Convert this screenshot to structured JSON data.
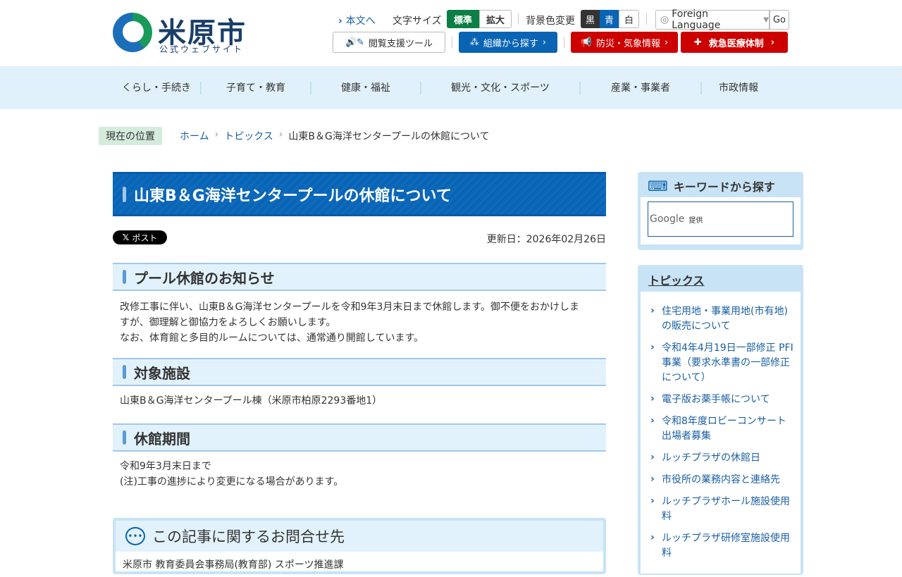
{
  "header": {
    "site_name": "米原市",
    "site_sub": "公式ウェブサイト",
    "skip_link": "本文へ",
    "font_size_label": "文字サイズ",
    "font_standard": "標準",
    "font_large": "拡大",
    "bg_label": "背景色変更",
    "bg_black": "黒",
    "bg_blue": "青",
    "bg_white": "白",
    "language": "Foreign Language",
    "go": "Go",
    "reading_tool": "閲覧支援ツール",
    "org_search": "組織から探す",
    "disaster": "防災・気象情報",
    "emergency": "救急医療体制"
  },
  "nav": [
    "くらし・手続き",
    "子育て・教育",
    "健康・福祉",
    "観光・文化・スポーツ",
    "産業・事業者",
    "市政情報"
  ],
  "breadcrumb": {
    "label": "現在の位置",
    "items": [
      "ホーム",
      "トピックス",
      "山東B＆G海洋センタープールの休館について"
    ]
  },
  "article": {
    "title": "山東B＆G海洋センタープールの休館について",
    "post_button": "ポスト",
    "updated": "更新日：2026年02月26日",
    "sections": [
      {
        "heading": "プール休館のお知らせ",
        "lines": [
          "改修工事に伴い、山東B＆G海洋センタープールを令和9年3月末日まで休館します。御不便をおかけしま",
          "すが、御理解と御協力をよろしくお願いします。",
          "なお、体育館と多目的ルームについては、通常通り開館しています。"
        ]
      },
      {
        "heading": "対象施設",
        "lines": [
          "山東B＆G海洋センタープール棟（米原市柏原2293番地1）"
        ]
      },
      {
        "heading": "休館期間",
        "lines": [
          "令和9年3月末日まで",
          "(注)工事の進捗により変更になる場合があります。"
        ]
      }
    ],
    "contact_heading": "この記事に関するお問合せ先",
    "contact_text": "米原市 教育委員会事務局(教育部) スポーツ推進課"
  },
  "sidebar": {
    "keyword_title": "キーワードから探す",
    "google": "Google",
    "provided": "提供",
    "topics_title": "トピックス",
    "topics": [
      "住宅用地・事業用地(市有地)の販売について",
      "令和4年4月19日一部修正 PFI事業（要求水準書の一部修正について）",
      "電子版お薬手帳について",
      "令和8年度ロビーコンサート出場者募集",
      "ルッチプラザの休館日",
      "市役所の業務内容と連絡先",
      "ルッチプラザホール施設使用料",
      "ルッチプラザ研修室施設使用料"
    ]
  },
  "colors": {
    "green": "#0b7f45",
    "blue": "#0a64b4",
    "red": "#cc0000"
  }
}
